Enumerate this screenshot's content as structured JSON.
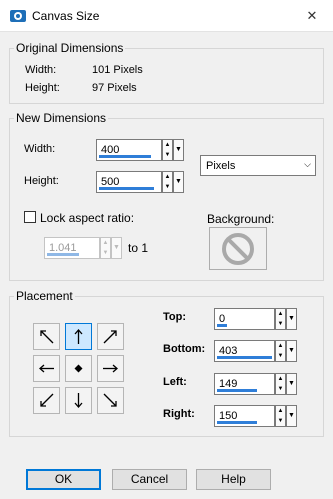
{
  "window": {
    "title": "Canvas Size",
    "close_glyph": "✕"
  },
  "original": {
    "title": "Original Dimensions",
    "width_label": "Width:",
    "width_value": "101 Pixels",
    "height_label": "Height:",
    "height_value": "97 Pixels"
  },
  "new_dims": {
    "title": "New Dimensions",
    "width_label": "Width:",
    "width_value": "400",
    "height_label": "Height:",
    "height_value": "500",
    "units": "Pixels",
    "lock_label": "Lock aspect ratio:",
    "lock_checked": false,
    "ratio_value": "1.041",
    "to_label": "to 1",
    "background_label": "Background:"
  },
  "placement": {
    "title": "Placement",
    "selected_anchor": "top-center",
    "top_label": "Top:",
    "top_value": "0",
    "bottom_label": "Bottom:",
    "bottom_value": "403",
    "left_label": "Left:",
    "left_value": "149",
    "right_label": "Right:",
    "right_value": "150"
  },
  "buttons": {
    "ok": "OK",
    "cancel": "Cancel",
    "help": "Help"
  },
  "colors": {
    "accent": "#2f7ed8",
    "focus": "#0078d7"
  }
}
